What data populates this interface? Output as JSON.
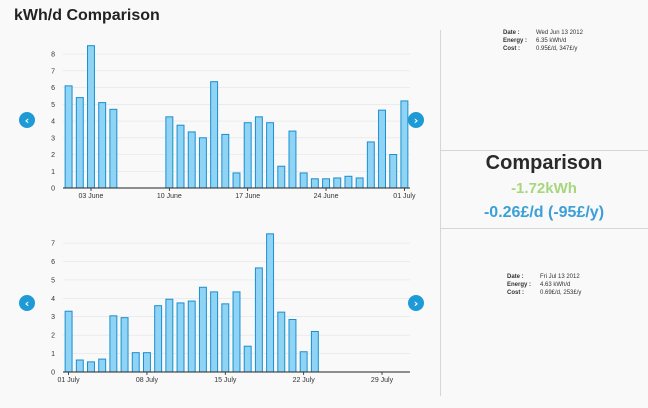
{
  "page": {
    "title": "kWh/d Comparison"
  },
  "colors": {
    "bar_fill": "#8fd3f5",
    "bar_stroke": "#1a8fd0",
    "nav": "#1e9ad6",
    "kwh": "#a7d67f",
    "cost": "#3b9fd8"
  },
  "icons": {
    "prev": "chevron-left-icon",
    "next": "chevron-right-icon"
  },
  "nav": {
    "prev_glyph": "‹",
    "next_glyph": "›"
  },
  "info_top": {
    "date_label": "Date :",
    "date": "Wed Jun 13 2012",
    "energy_label": "Energy :",
    "energy": "6.35 kWh/d",
    "cost_label": "Cost :",
    "cost": "0.95£/d, 347£/y"
  },
  "info_bottom": {
    "date_label": "Date :",
    "date": "Fri Jul 13 2012",
    "energy_label": "Energy :",
    "energy": "4.63 kWh/d",
    "cost_label": "Cost :",
    "cost": "0.69£/d, 253£/y"
  },
  "comparison": {
    "title": "Comparison",
    "kwh": "-1.72kWh",
    "cost": "-0.26£/d (-95£/y)"
  },
  "chart_data": [
    {
      "type": "bar",
      "title": "",
      "x_start_day": 1,
      "days": 31,
      "xticks": [
        {
          "day": 3,
          "label": "03 June"
        },
        {
          "day": 10,
          "label": "10 June"
        },
        {
          "day": 17,
          "label": "17 June"
        },
        {
          "day": 24,
          "label": "24 June"
        },
        {
          "day": 31,
          "label": "01 July"
        }
      ],
      "yticks": [
        0,
        1,
        2,
        3,
        4,
        5,
        6,
        7,
        8
      ],
      "ylim": [
        0,
        8.6
      ],
      "values": [
        6.1,
        5.4,
        8.5,
        5.1,
        4.7,
        null,
        null,
        null,
        null,
        4.25,
        3.75,
        3.35,
        3.0,
        6.35,
        3.2,
        0.9,
        3.9,
        4.25,
        3.9,
        1.3,
        3.4,
        0.9,
        0.55,
        0.55,
        0.6,
        0.7,
        0.6,
        2.75,
        4.65,
        2.0,
        5.2
      ]
    },
    {
      "type": "bar",
      "title": "",
      "x_start_day": 1,
      "days": 31,
      "xticks": [
        {
          "day": 1,
          "label": "01 July"
        },
        {
          "day": 8,
          "label": "08 July"
        },
        {
          "day": 15,
          "label": "15 July"
        },
        {
          "day": 22,
          "label": "22 July"
        },
        {
          "day": 29,
          "label": "29 July"
        }
      ],
      "yticks": [
        0,
        1,
        2,
        3,
        4,
        5,
        6,
        7
      ],
      "ylim": [
        0,
        7.6
      ],
      "values": [
        3.3,
        0.65,
        0.55,
        0.7,
        3.05,
        2.95,
        1.05,
        1.05,
        3.6,
        3.95,
        3.75,
        3.85,
        4.6,
        4.35,
        3.7,
        4.35,
        1.4,
        5.65,
        7.5,
        3.25,
        2.85,
        1.1,
        2.2,
        null,
        null,
        null,
        null,
        null,
        null,
        null,
        null
      ]
    }
  ]
}
